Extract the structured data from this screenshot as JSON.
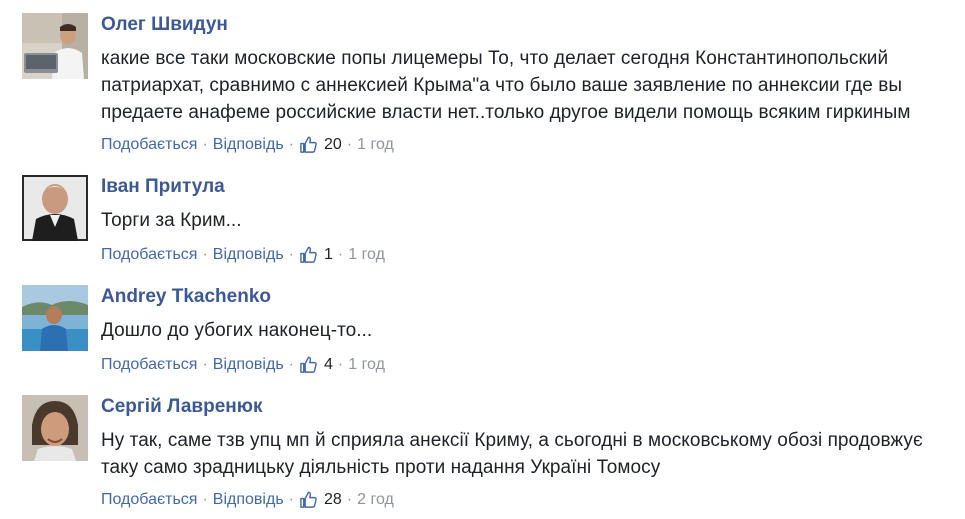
{
  "comments": [
    {
      "author": "Олег Швидун",
      "text": "какие все таки московские попы лицемеры То, что делает сегодня Константинопольский патриархат, сравнимо с аннексией Крыма\"а что было ваше заявление по аннексии где вы предаете анафеме российские власти нет..только другое видели помощь всяким гиркиным",
      "like_label": "Подобається",
      "reply_label": "Відповідь",
      "likes": "20",
      "time": "1 год"
    },
    {
      "author": "Іван Притула",
      "text": "Торги за Крим...",
      "like_label": "Подобається",
      "reply_label": "Відповідь",
      "likes": "1",
      "time": "1 год"
    },
    {
      "author": "Andrey Tkachenko",
      "text": "Дошло до убогих наконец-то...",
      "like_label": "Подобається",
      "reply_label": "Відповідь",
      "likes": "4",
      "time": "1 год"
    },
    {
      "author": "Сергій Лавренюк",
      "text": "Ну так, саме тзв упц мп й сприяла анексії Криму, а сьогодні в московському обозі продовжує таку само зрадницьку діяльність проти надання Україні Томосу",
      "like_label": "Подобається",
      "reply_label": "Відповідь",
      "likes": "28",
      "time": "2 год"
    }
  ],
  "colors": {
    "author": "#3b5998",
    "link": "#4267b2",
    "meta": "#90949c",
    "text": "#1d2129"
  }
}
